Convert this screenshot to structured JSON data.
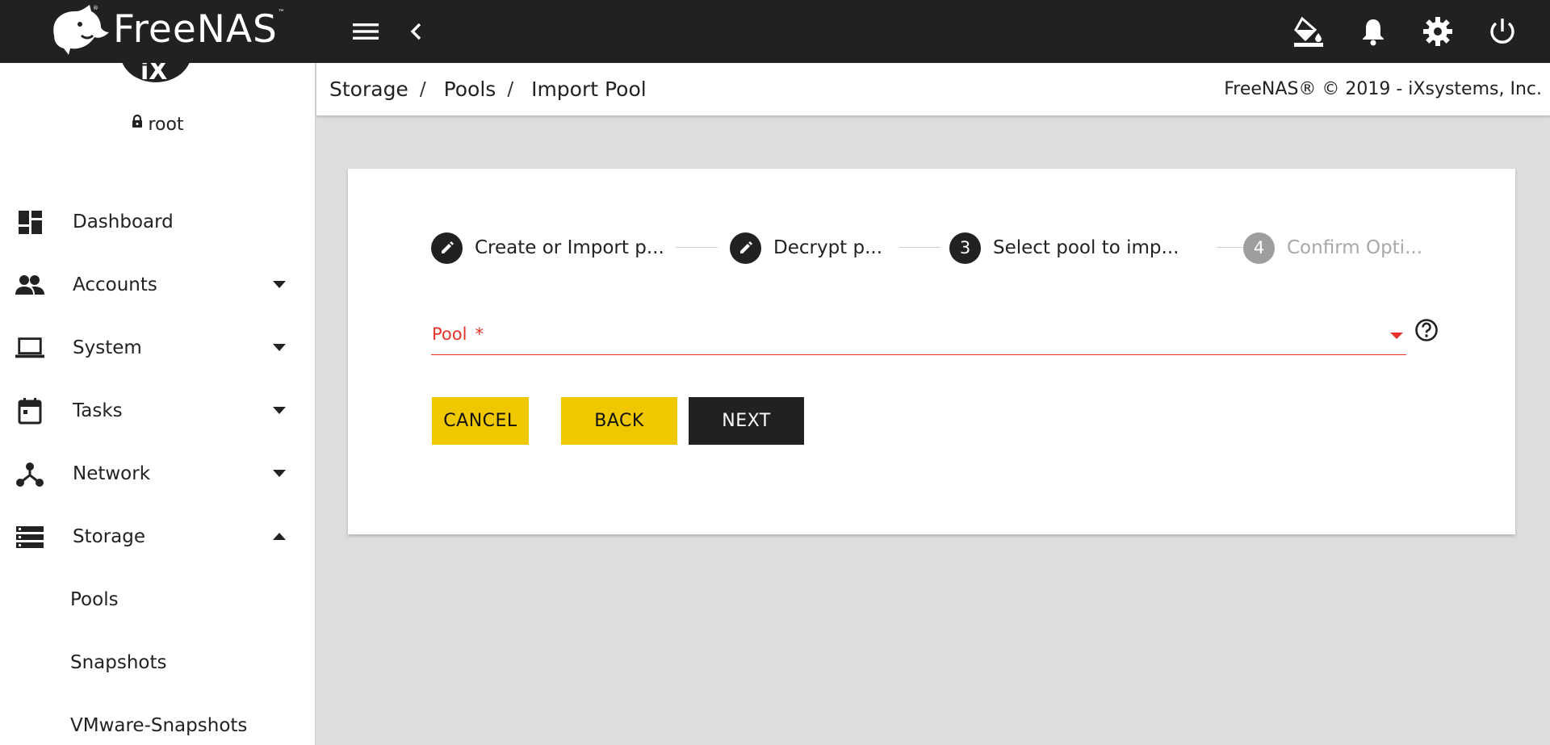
{
  "app": {
    "brand_name": "FreeNAS",
    "brand_tm": "™"
  },
  "topbar": {
    "menu_icon": "menu-icon",
    "back_icon": "chevron-left-icon",
    "right_icons": [
      "theme-paint-icon",
      "bell-icon",
      "gear-icon",
      "power-icon"
    ]
  },
  "sidebar": {
    "user": "root",
    "items": [
      {
        "label": "Dashboard",
        "icon": "dashboard-icon"
      },
      {
        "label": "Accounts",
        "icon": "people-icon",
        "caret": "down"
      },
      {
        "label": "System",
        "icon": "laptop-icon",
        "caret": "down"
      },
      {
        "label": "Tasks",
        "icon": "calendar-icon",
        "caret": "down"
      },
      {
        "label": "Network",
        "icon": "network-icon",
        "caret": "down"
      },
      {
        "label": "Storage",
        "icon": "storage-icon",
        "caret": "up"
      }
    ],
    "subitems": [
      "Pools",
      "Snapshots",
      "VMware-Snapshots"
    ]
  },
  "breadcrumb": {
    "items": [
      "Storage",
      "Pools",
      "Import Pool"
    ],
    "separator": "/",
    "copyright": "FreeNAS® © 2019 - iXsystems, Inc."
  },
  "wizard": {
    "steps": [
      {
        "label": "Create or Import p...",
        "marker": "edit",
        "state": "done"
      },
      {
        "label": "Decrypt p...",
        "marker": "edit",
        "state": "done"
      },
      {
        "label": "Select pool to imp...",
        "marker": "3",
        "state": "active"
      },
      {
        "label": "Confirm Opti...",
        "marker": "4",
        "state": "pending"
      }
    ],
    "pool_field": {
      "label": "Pool",
      "required_mark": "*",
      "value": ""
    },
    "buttons": {
      "cancel": "CANCEL",
      "back": "BACK",
      "next": "NEXT"
    }
  },
  "colors": {
    "topbar": "#212121",
    "accent_yellow": "#f0c800",
    "error_red": "#e6342b",
    "background": "#dddddd"
  }
}
